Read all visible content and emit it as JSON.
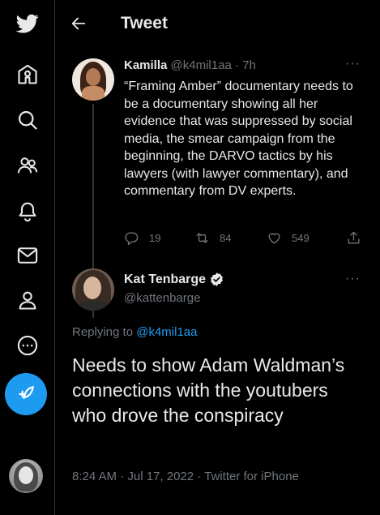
{
  "header": {
    "title": "Tweet"
  },
  "nav": {
    "items": [
      "twitter-logo",
      "home-icon",
      "explore-icon",
      "communities-icon",
      "notifications-icon",
      "messages-icon",
      "profile-icon",
      "more-icon"
    ],
    "compose_icon": "compose-tweet-icon",
    "accent_color": "#1d9bf0"
  },
  "reply_to_tweet": {
    "name": "Kamilla",
    "handle": "@k4mil1aa",
    "time": "· 7h",
    "text": "“Framing Amber” documentary needs to be a documentary showing all her evidence that was suppressed by social media, the smear campaign from the beginning, the DARVO tactics by his lawyers (with lawyer commentary), and commentary from DV experts.",
    "replies": "19",
    "retweets": "84",
    "likes": "549"
  },
  "main_tweet": {
    "name": "Kat Tenbarge",
    "handle": "@kattenbarge",
    "replying_prefix": "Replying to",
    "replying_handle": "@k4mil1aa",
    "text": "Needs to show Adam Waldman’s connections with the youtubers who drove the conspiracy",
    "timestamp": "8:24 AM · Jul 17, 2022 · Twitter for iPhone"
  },
  "colors": {
    "background": "#000000",
    "text_primary": "#e7e9ea",
    "text_secondary": "#71767b",
    "link": "#1d9bf0"
  }
}
